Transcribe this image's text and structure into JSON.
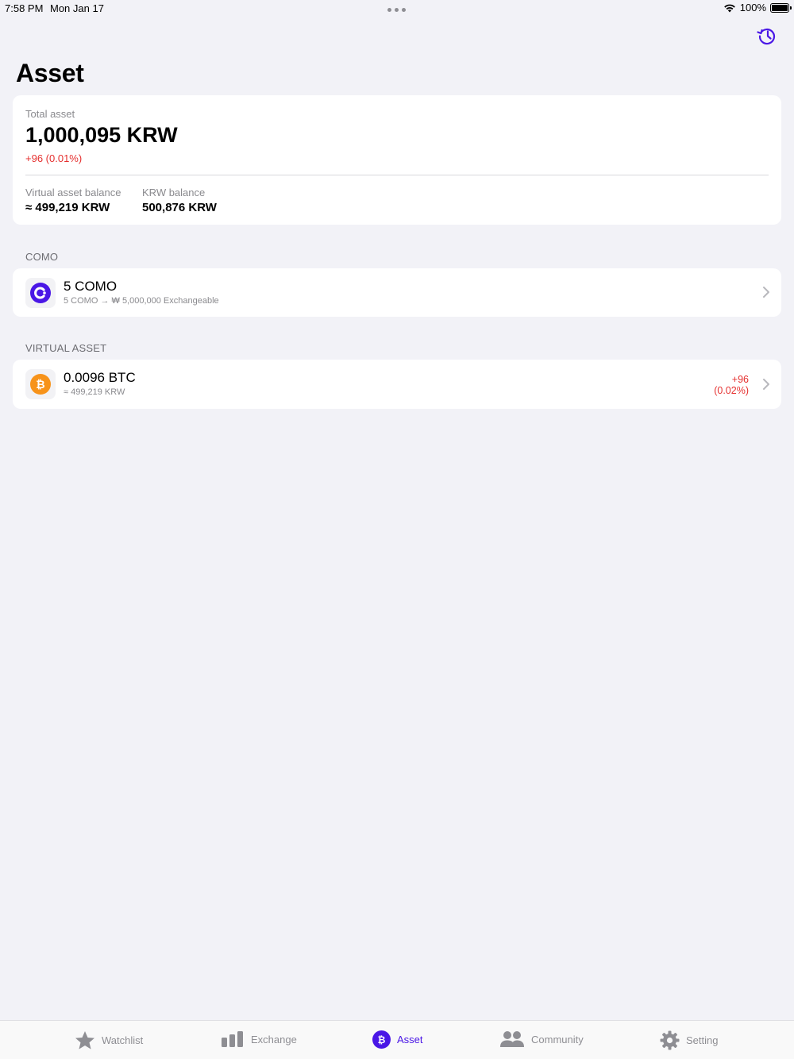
{
  "status_bar": {
    "time": "7:58 PM",
    "date": "Mon Jan 17",
    "battery": "100%"
  },
  "header": {
    "title": "Asset",
    "history_icon": "history-icon"
  },
  "summary": {
    "total_label": "Total asset",
    "total_value": "1,000,095 KRW",
    "total_change": "+96 (0.01%)",
    "virtual_label": "Virtual asset balance",
    "virtual_value": "≈ 499,219 KRW",
    "krw_label": "KRW balance",
    "krw_value": "500,876 KRW"
  },
  "como_section": {
    "label": "COMO",
    "item": {
      "title": "5 COMO",
      "subtitle": "5 COMO → ₩ 5,000,000 Exchangeable",
      "icon": "como-logo-icon"
    }
  },
  "virtual_section": {
    "label": "VIRTUAL ASSET",
    "item": {
      "title": "0.0096 BTC",
      "subtitle": "≈ 499,219 KRW",
      "change_amount": "+96",
      "change_percent": "(0.02%)",
      "icon": "bitcoin-icon"
    }
  },
  "tab_bar": {
    "tabs": [
      {
        "label": "Watchlist",
        "icon": "star-icon",
        "active": false
      },
      {
        "label": "Exchange",
        "icon": "bar-chart-icon",
        "active": false
      },
      {
        "label": "Asset",
        "icon": "bitcoin-circle-icon",
        "active": true
      },
      {
        "label": "Community",
        "icon": "people-icon",
        "active": false
      },
      {
        "label": "Setting",
        "icon": "gear-icon",
        "active": false
      }
    ]
  },
  "colors": {
    "accent": "#4a17e6",
    "negative_change": "#e5302f",
    "bitcoin": "#f7931a",
    "background": "#f2f2f7"
  }
}
